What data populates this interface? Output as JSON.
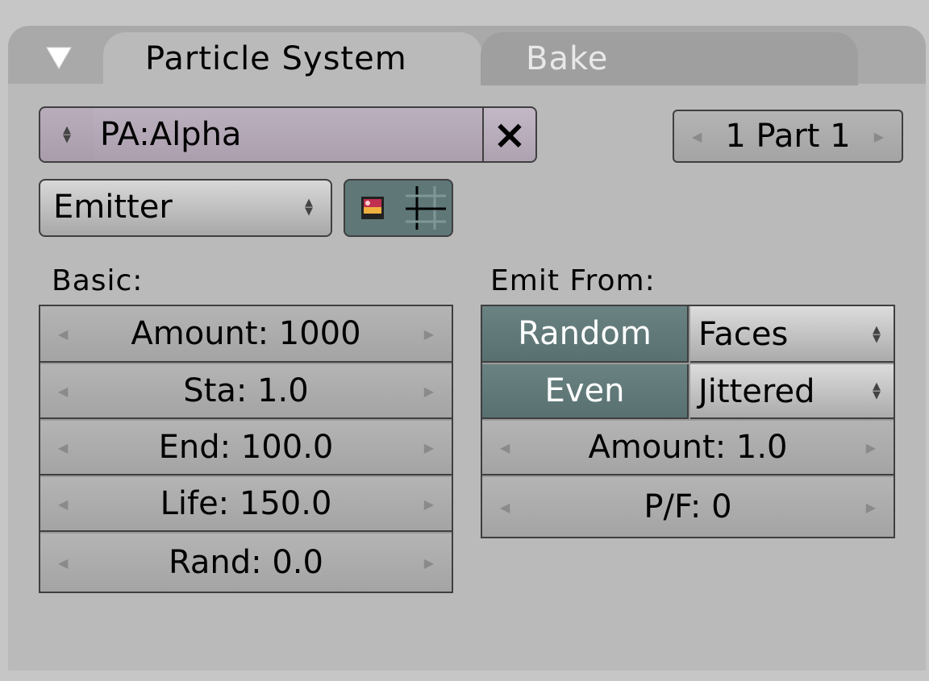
{
  "tabs": {
    "active_label": "Particle System",
    "inactive_label": "Bake"
  },
  "datablock": {
    "name": "PA:Alpha",
    "clear_glyph": "×",
    "counter_label": "1 Part 1"
  },
  "type_select": {
    "value": "Emitter"
  },
  "basic": {
    "heading": "Basic:",
    "fields": [
      {
        "label": "Amount: 1000"
      },
      {
        "label": "Sta: 1.0"
      },
      {
        "label": "End: 100.0"
      },
      {
        "label": "Life: 150.0"
      },
      {
        "label": "Rand: 0.0"
      }
    ]
  },
  "emit_from": {
    "heading": "Emit From:",
    "random_label": "Random",
    "random_select": "Faces",
    "even_label": "Even",
    "even_select": "Jittered",
    "amount_label": "Amount: 1.0",
    "pf_label": "P/F: 0"
  },
  "colors": {
    "panel_bg": "#bababa",
    "datablock_bg": "#b5a9b9",
    "toggle_on_bg": "#5f7777",
    "field_bg": "#aaaaaa"
  }
}
